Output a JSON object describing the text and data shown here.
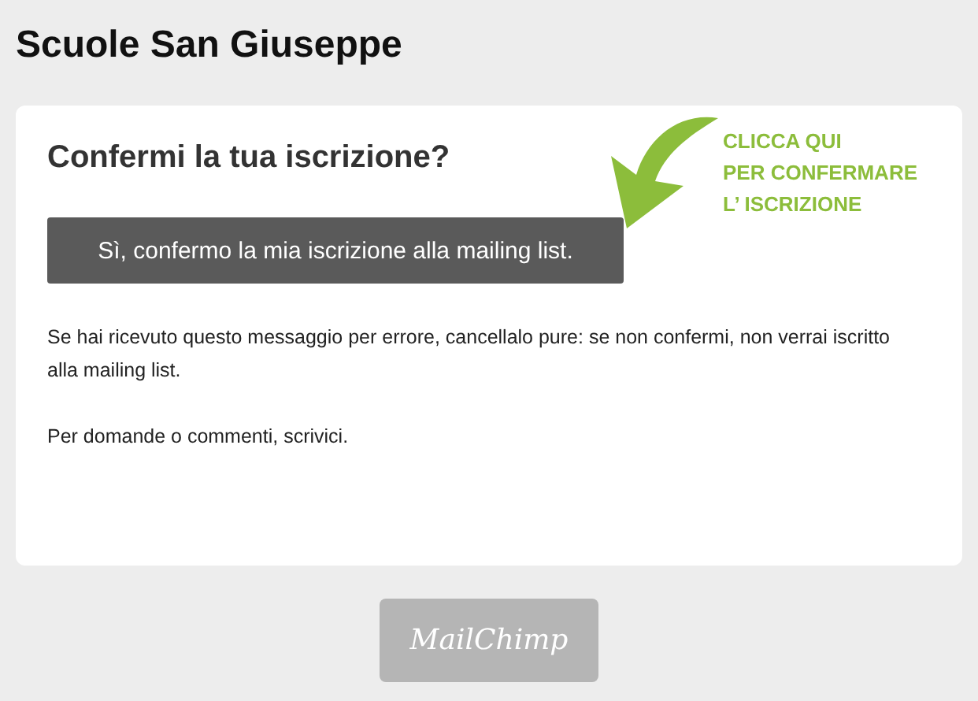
{
  "site_title": "Scuole San Giuseppe",
  "card": {
    "heading": "Confermi la tua iscrizione?",
    "confirm_button": "Sì, confermo la mia iscrizione alla mailing list.",
    "paragraphs": [
      "Se hai ricevuto questo messaggio per errore, cancellalo pure: se non confermi, non verrai iscritto alla mailing list.",
      "Per domande o commenti, scrivici."
    ]
  },
  "annotation": {
    "lines": [
      "CLICCA QUI",
      "PER CONFERMARE",
      "L’ ISCRIZIONE"
    ]
  },
  "footer_logo": "MailChimp"
}
